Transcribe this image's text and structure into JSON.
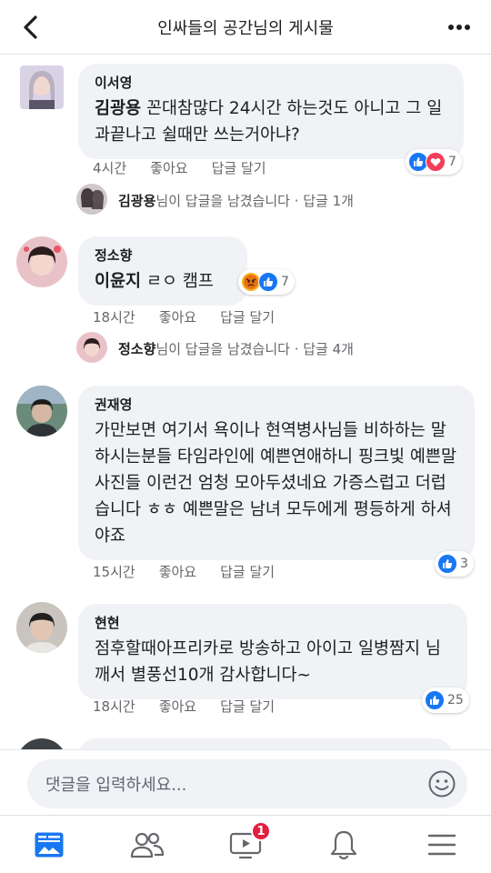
{
  "header": {
    "title": "인싸들의 공간님의 게시물"
  },
  "comments": [
    {
      "author": "이서영",
      "mention": "김광용",
      "text": " 꼰대참많다 24시간 하는것도 아니고 그 일과끝나고 쉴때만 쓰는거아냐?",
      "time": "4시간",
      "like_label": "좋아요",
      "reply_label": "답글 달기",
      "reaction_count": "7",
      "reply_summary": {
        "name": "김광용",
        "text": "님이 답글을 남겼습니다 · 답글 1개"
      }
    },
    {
      "author": "정소향",
      "mention": "이윤지",
      "text": " ㄹㅇ 캠프",
      "time": "18시간",
      "like_label": "좋아요",
      "reply_label": "답글 달기",
      "reaction_count": "7",
      "reply_summary": {
        "name": "정소향",
        "text": "님이 답글을 남겼습니다 · 답글 4개"
      }
    },
    {
      "author": "권재영",
      "text": "가만보면 여기서 욕이나 현역병사님들 비하하는 말 하시는분들 타임라인에 예쁜연애하니 핑크빛 예쁜말 사진들 이런건 엄청 모아두셨네요 가증스럽고 더럽습니다 ㅎㅎ 예쁜말은 남녀 모두에게 평등하게 하셔야죠",
      "time": "15시간",
      "like_label": "좋아요",
      "reply_label": "답글 달기",
      "reaction_count": "3"
    },
    {
      "author": "현현",
      "text": "점후할때아프리카로 방송하고 아이고 일병짬지 님깨서 별풍선10개 감사합니다~",
      "time": "18시간",
      "like_label": "좋아요",
      "reply_label": "답글 달기",
      "reaction_count": "25"
    }
  ],
  "compose": {
    "placeholder": "댓글을 입력하세요..."
  },
  "tabbar": {
    "video_badge": "1"
  },
  "colors": {
    "like": "#1877f2",
    "love": "#f33e58",
    "angry": "#f7b125",
    "badge": "#e41e3f",
    "bubble": "#f0f2f5"
  }
}
